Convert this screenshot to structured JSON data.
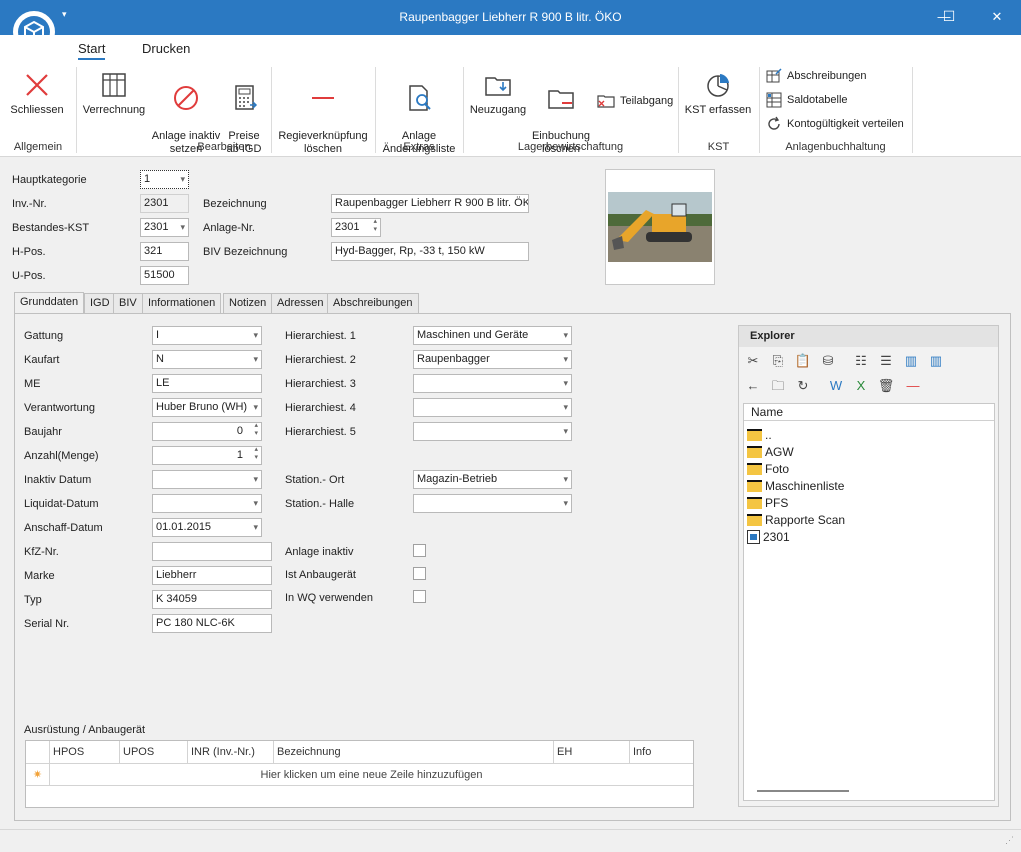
{
  "window": {
    "title": "Raupenbagger Liebherr R 900 B litr. ÖKO",
    "minimize": "—",
    "maximize": "☐",
    "close": "✕",
    "qa_arrow": "▾"
  },
  "ribbon_tabs": [
    "Start",
    "Drucken"
  ],
  "ribbon": {
    "schliessen": "Schliessen",
    "verrechnung": "Verrechnung",
    "anlage_inaktiv": "Anlage inaktiv\nsetzen",
    "preise": "Preise\nab IGD",
    "regie": "Regieverknüpfung\nlöschen",
    "anlage_aenderung": "Anlage\nÄnderungsliste",
    "neuzugang": "Neuzugang",
    "einbuchung": "Einbuchung\nlöschen",
    "teilabgang": "Teilabgang",
    "kst_erfassen": "KST erfassen",
    "abschreibungen": "Abschreibungen",
    "saldotabelle": "Saldotabelle",
    "kontogueltigkeit": "Kontogültigkeit verteilen",
    "groups": [
      "Allgemein",
      "Bearbeiten",
      "Extras",
      "Lagerbewirtschaftung",
      "KST",
      "Anlagenbuchhaltung"
    ]
  },
  "header": {
    "hauptkategorie_label": "Hauptkategorie",
    "hauptkategorie": "1",
    "inv_label": "Inv.-Nr.",
    "inv": "2301",
    "bestandes_label": "Bestandes-KST",
    "bestandes": "2301",
    "hpos_label": "H-Pos.",
    "hpos": "321",
    "upos_label": "U-Pos.",
    "upos": "51500",
    "bezeichnung_label": "Bezeichnung",
    "bezeichnung": "Raupenbagger Liebherr R 900 B litr. ÖKO",
    "anlage_nr_label": "Anlage-Nr.",
    "anlage_nr": "2301",
    "biv_label": "BIV Bezeichnung",
    "biv": "Hyd-Bagger, Rp, -33 t, 150 kW"
  },
  "tabs": [
    "Grunddaten",
    "IGD",
    "BIV",
    "Informationen",
    "Notizen",
    "Adressen",
    "Abschreibungen"
  ],
  "grunddaten": {
    "gattung_label": "Gattung",
    "gattung": "I",
    "kaufart_label": "Kaufart",
    "kaufart": "N",
    "me_label": "ME",
    "me": "LE",
    "verantwortung_label": "Verantwortung",
    "verantwortung": "Huber Bruno (WH)",
    "baujahr_label": "Baujahr",
    "baujahr": "0",
    "anzahl_label": "Anzahl(Menge)",
    "anzahl": "1",
    "inaktiv_label": "Inaktiv Datum",
    "inaktiv": "",
    "liquidat_label": "Liquidat-Datum",
    "liquidat": "",
    "anschaff_label": "Anschaff-Datum",
    "anschaff": "01.01.2015",
    "kfz_label": "KfZ-Nr.",
    "kfz": "",
    "marke_label": "Marke",
    "marke": "Liebherr",
    "typ_label": "Typ",
    "typ": "K 34059",
    "serial_label": "Serial Nr.",
    "serial": "PC 180 NLC-6K",
    "hier1_label": "Hierarchiest. 1",
    "hier1": "Maschinen und Geräte",
    "hier2_label": "Hierarchiest. 2",
    "hier2": "Raupenbagger",
    "hier3_label": "Hierarchiest. 3",
    "hier3": "",
    "hier4_label": "Hierarchiest. 4",
    "hier4": "",
    "hier5_label": "Hierarchiest. 5",
    "hier5": "",
    "station_ort_label": "Station.- Ort",
    "station_ort": "Magazin-Betrieb",
    "station_halle_label": "Station.- Halle",
    "station_halle": "",
    "anlage_inaktiv_label": "Anlage inaktiv",
    "anbaugeraet_label": "Ist Anbaugerät",
    "wq_label": "In WQ verwenden"
  },
  "explorer": {
    "title": "Explorer",
    "col_name": "Name",
    "items": [
      "..",
      "AGW",
      "Foto",
      "Maschinenliste",
      "PFS",
      "Rapporte Scan",
      "2301"
    ]
  },
  "ausruestung": {
    "title": "Ausrüstung / Anbaugerät",
    "columns": [
      "HPOS",
      "UPOS",
      "INR (Inv.-Nr.)",
      "Bezeichnung",
      "EH",
      "Info"
    ],
    "new_row_marker": "✷",
    "new_row_hint": "Hier klicken um eine neue Zeile hinzuzufügen"
  },
  "colors": {
    "accent": "#2b79c2",
    "danger": "#e03c3c"
  }
}
